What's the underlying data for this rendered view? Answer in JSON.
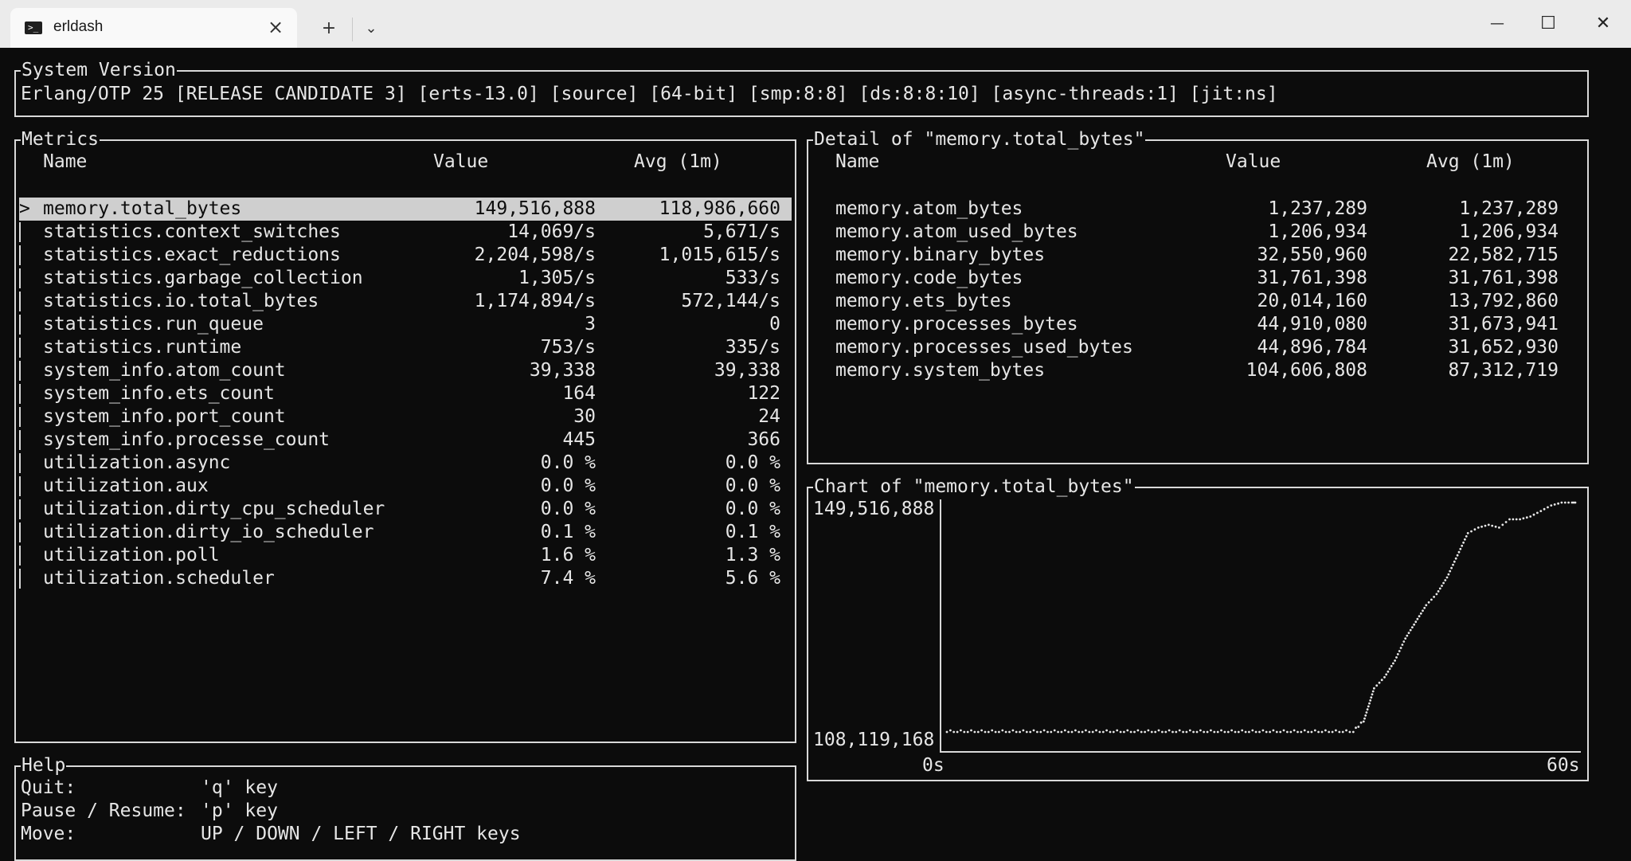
{
  "window": {
    "tab_title": "erldash",
    "tab_close_icon": "×",
    "new_tab_icon": "+",
    "dropdown_icon": "⌄",
    "minimize_icon": "—",
    "maximize_icon": "☐",
    "close_icon": "✕"
  },
  "system_version": {
    "title": "System Version",
    "text": "Erlang/OTP 25 [RELEASE CANDIDATE 3] [erts-13.0] [source] [64-bit] [smp:8:8] [ds:8:8:10] [async-threads:1] [jit:ns]"
  },
  "metrics": {
    "title": "Metrics",
    "headers": {
      "name": "Name",
      "value": "Value",
      "avg": "Avg (1m)"
    },
    "selected_marker": ">",
    "rows": [
      {
        "name": "memory.total_bytes",
        "value": "149,516,888",
        "avg": "118,986,660"
      },
      {
        "name": "statistics.context_switches",
        "value": "14,069/s",
        "avg": "5,671/s"
      },
      {
        "name": "statistics.exact_reductions",
        "value": "2,204,598/s",
        "avg": "1,015,615/s"
      },
      {
        "name": "statistics.garbage_collection",
        "value": "1,305/s",
        "avg": "533/s"
      },
      {
        "name": "statistics.io.total_bytes",
        "value": "1,174,894/s",
        "avg": "572,144/s"
      },
      {
        "name": "statistics.run_queue",
        "value": "3",
        "avg": "0"
      },
      {
        "name": "statistics.runtime",
        "value": "753/s",
        "avg": "335/s"
      },
      {
        "name": "system_info.atom_count",
        "value": "39,338",
        "avg": "39,338"
      },
      {
        "name": "system_info.ets_count",
        "value": "164",
        "avg": "122"
      },
      {
        "name": "system_info.port_count",
        "value": "30",
        "avg": "24"
      },
      {
        "name": "system_info.processe_count",
        "value": "445",
        "avg": "366"
      },
      {
        "name": "utilization.async",
        "value": "0.0 %",
        "avg": "0.0 %"
      },
      {
        "name": "utilization.aux",
        "value": "0.0 %",
        "avg": "0.0 %"
      },
      {
        "name": "utilization.dirty_cpu_scheduler",
        "value": "0.0 %",
        "avg": "0.0 %"
      },
      {
        "name": "utilization.dirty_io_scheduler",
        "value": "0.1 %",
        "avg": "0.1 %"
      },
      {
        "name": "utilization.poll",
        "value": "1.6 %",
        "avg": "1.3 %"
      },
      {
        "name": "utilization.scheduler",
        "value": "7.4 %",
        "avg": "5.6 %"
      }
    ]
  },
  "detail": {
    "title": "Detail of \"memory.total_bytes\"",
    "headers": {
      "name": "Name",
      "value": "Value",
      "avg": "Avg (1m)"
    },
    "rows": [
      {
        "name": "memory.atom_bytes",
        "value": "1,237,289",
        "avg": "1,237,289"
      },
      {
        "name": "memory.atom_used_bytes",
        "value": "1,206,934",
        "avg": "1,206,934"
      },
      {
        "name": "memory.binary_bytes",
        "value": "32,550,960",
        "avg": "22,582,715"
      },
      {
        "name": "memory.code_bytes",
        "value": "31,761,398",
        "avg": "31,761,398"
      },
      {
        "name": "memory.ets_bytes",
        "value": "20,014,160",
        "avg": "13,792,860"
      },
      {
        "name": "memory.processes_bytes",
        "value": "44,910,080",
        "avg": "31,673,941"
      },
      {
        "name": "memory.processes_used_bytes",
        "value": "44,896,784",
        "avg": "31,652,930"
      },
      {
        "name": "memory.system_bytes",
        "value": "104,606,808",
        "avg": "87,312,719"
      }
    ]
  },
  "chart_panel": {
    "title": "Chart of \"memory.total_bytes\""
  },
  "chart_data": {
    "type": "scatter",
    "ylim": [
      108119168,
      149516888
    ],
    "y_tick_labels": [
      "149,516,888",
      "108,119,168"
    ],
    "x_tick_labels": [
      "0s",
      "60s"
    ],
    "x": [
      0,
      1,
      2,
      3,
      4,
      5,
      6,
      7,
      8,
      9,
      10,
      11,
      12,
      13,
      14,
      15,
      16,
      17,
      18,
      19,
      20,
      21,
      22,
      23,
      24,
      25,
      26,
      27,
      28,
      29,
      30,
      31,
      32,
      33,
      34,
      35,
      36,
      37,
      38,
      39,
      40,
      41,
      42,
      43,
      44,
      45,
      46,
      47,
      48,
      49,
      50,
      51,
      52,
      53,
      54,
      55,
      56,
      57,
      58,
      59,
      60
    ],
    "y": [
      108119168,
      108119168,
      108119168,
      108119168,
      108119168,
      108119168,
      108119168,
      108119168,
      108119168,
      108119168,
      108119168,
      108119168,
      108119168,
      108119168,
      108119168,
      108119168,
      108119168,
      108119168,
      108119168,
      108119168,
      108119168,
      108119168,
      108119168,
      108119168,
      108119168,
      108119168,
      108119168,
      108119168,
      108119168,
      108119168,
      108119168,
      108119168,
      108119168,
      108119168,
      108119168,
      108119168,
      108119168,
      108119168,
      108119168,
      108119168,
      110000000,
      116000000,
      118000000,
      121000000,
      125000000,
      128000000,
      131000000,
      133000000,
      136000000,
      140000000,
      144000000,
      145000000,
      145500000,
      145000000,
      146500000,
      146500000,
      147000000,
      148000000,
      149000000,
      149516888,
      149516888
    ]
  },
  "help": {
    "title": "Help",
    "lines": [
      {
        "label": "Quit:",
        "keys": "'q' key"
      },
      {
        "label": "Pause / Resume:",
        "keys": "'p' key"
      },
      {
        "label": "Move:",
        "keys": "UP / DOWN / LEFT / RIGHT keys"
      }
    ]
  }
}
